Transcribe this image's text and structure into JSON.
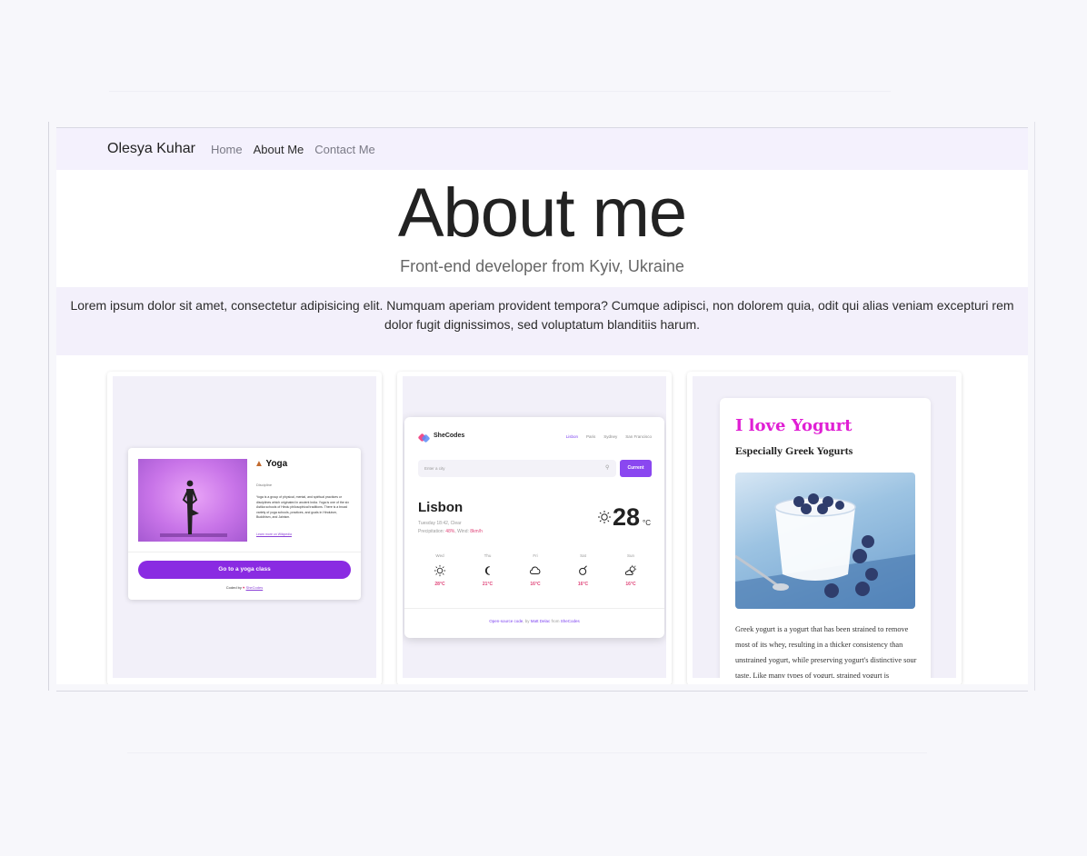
{
  "nav": {
    "brand": "Olesya Kuhar",
    "links": [
      "Home",
      "About Me",
      "Contact Me"
    ]
  },
  "hero": {
    "title": "About me",
    "subtitle": "Front-end developer from Kyiv, Ukraine"
  },
  "intro": "Lorem ipsum dolor sit amet, consectetur adipisicing elit. Numquam aperiam provident tempora? Cumque adipisci, non dolorem quia, odit qui alias veniam excepturi rem dolor fugit dignissimos, sed voluptatum blanditiis harum.",
  "projects": {
    "yoga": {
      "title": "Yoga",
      "subtitle": "Discipline",
      "description": "Yoga is a group of physical, mental, and spiritual practices or disciplines which originated in ancient India. Yoga is one of the six Astika schools of Hindu philosophical traditions. There is a broad variety of yoga schools, practices, and goals in Hinduism, Buddhism, and Jainism.",
      "link": "Learn more on Wikipedia",
      "button": "Go to a yoga class",
      "coded_by": "Coded by",
      "coded_link": "SheCodes"
    },
    "weather": {
      "logo": "SheCodes",
      "cities": [
        "Lisbon",
        "Paris",
        "Sydney",
        "San Francisco"
      ],
      "search_placeholder": "Enter a city",
      "current_button": "Current",
      "city": "Lisbon",
      "datetime": "Tuesday 18:42, Clear",
      "precip_label": "Precipitation:",
      "precip_value": "48%",
      "wind_label": ", Wind:",
      "wind_value": "8km/h",
      "temp": "28",
      "unit": "°C",
      "forecast": [
        {
          "day": "Wed",
          "temp": "28°C",
          "icon": "sun-icon"
        },
        {
          "day": "Thu",
          "temp": "21°C",
          "icon": "moon-icon"
        },
        {
          "day": "Fri",
          "temp": "16°C",
          "icon": "cloud-icon"
        },
        {
          "day": "Sat",
          "temp": "16°C",
          "icon": "rain-icon"
        },
        {
          "day": "Sun",
          "temp": "16°C",
          "icon": "partly-sunny-icon"
        }
      ],
      "footer_link": "Open-source code",
      "footer_by": ", by",
      "footer_author": "Matt Delac",
      "footer_from": "from",
      "footer_org": "SheCodes"
    },
    "yogurt": {
      "title": "I love Yogurt",
      "subtitle": "Especially Greek Yogurts",
      "text": "Greek yogurt is a yogurt that has been strained to remove most of its whey, resulting in a thicker consistency than unstrained yogurt, while preserving yogurt's distinctive sour taste. Like many types of yogurt, strained yogurt is"
    }
  },
  "colors": {
    "navbar_bg": "#f4f1fd",
    "intro_bg": "#f3f0fb",
    "yoga_button": "#8a2be2",
    "weather_accent": "#8a47f0",
    "weather_highlight": "#e0467a",
    "yogurt_title": "#e01fd4"
  }
}
